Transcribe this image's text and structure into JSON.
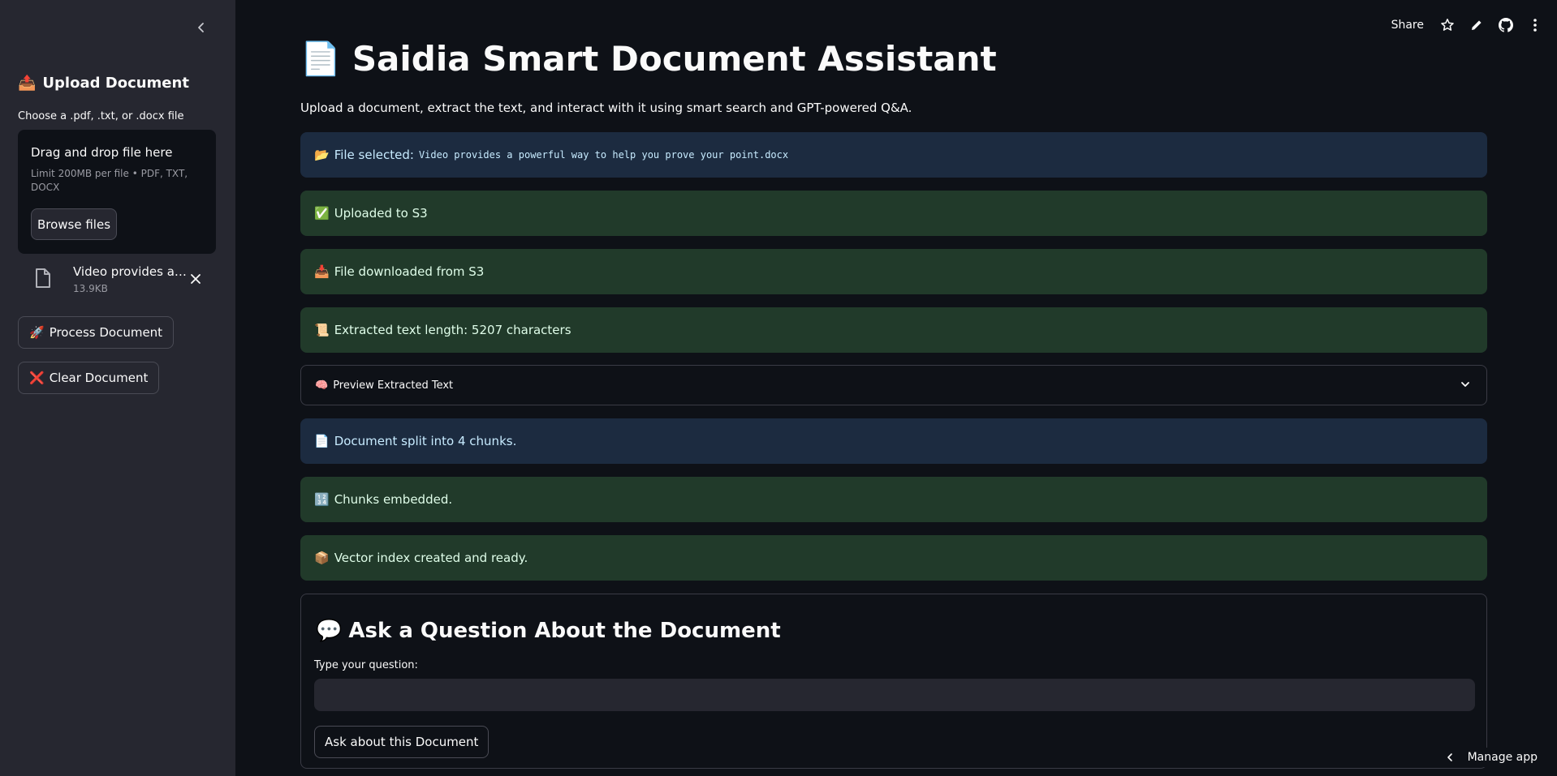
{
  "sidebar": {
    "heading_icon": "📤",
    "heading": "Upload Document",
    "uploader_label": "Choose a .pdf, .txt, or .docx file",
    "dropzone": {
      "title": "Drag and drop file here",
      "limit": "Limit 200MB per file • PDF, TXT, DOCX",
      "browse_label": "Browse files"
    },
    "uploaded_file": {
      "name": "Video provides a powerful way to help you prove your point.docx",
      "size": "13.9KB"
    },
    "process_icon": "🚀",
    "process_label": "Process Document",
    "clear_icon": "❌",
    "clear_label": "Clear Document"
  },
  "header": {
    "share_label": "Share",
    "icons": [
      "star-icon",
      "pencil-icon",
      "github-icon",
      "more-vertical-icon"
    ]
  },
  "main": {
    "title_icon": "📄",
    "title": "Saidia Smart Document Assistant",
    "subtitle": "Upload a document, extract the text, and interact with it using smart search and GPT-powered Q&A.",
    "file_selected": {
      "icon": "📂",
      "label": "File selected:",
      "filename": "Video provides a powerful way to help you prove your point.docx"
    },
    "alerts": [
      {
        "icon": "✅",
        "text": "Uploaded to S3"
      },
      {
        "icon": "📥",
        "text": "File downloaded from S3"
      },
      {
        "icon": "📜",
        "text": "Extracted text length: 5207 characters"
      }
    ],
    "expander": {
      "icon": "🧠",
      "label": "Preview Extracted Text"
    },
    "alerts2": [
      {
        "icon": "📄",
        "text": "Document split into 4 chunks."
      },
      {
        "icon": "🔢",
        "text": "Chunks embedded."
      },
      {
        "icon": "📦",
        "text": "Vector index created and ready."
      }
    ],
    "qa": {
      "icon": "💬",
      "title": "Ask a Question About the Document",
      "input_label": "Type your question:",
      "input_value": "",
      "ask_label": "Ask about this Document"
    }
  },
  "footer": {
    "manage_label": "Manage app"
  },
  "colors": {
    "background": "#0e1117",
    "sidebar": "#262730",
    "info_bg": "#1c2b40",
    "success_bg": "#213a2a"
  }
}
